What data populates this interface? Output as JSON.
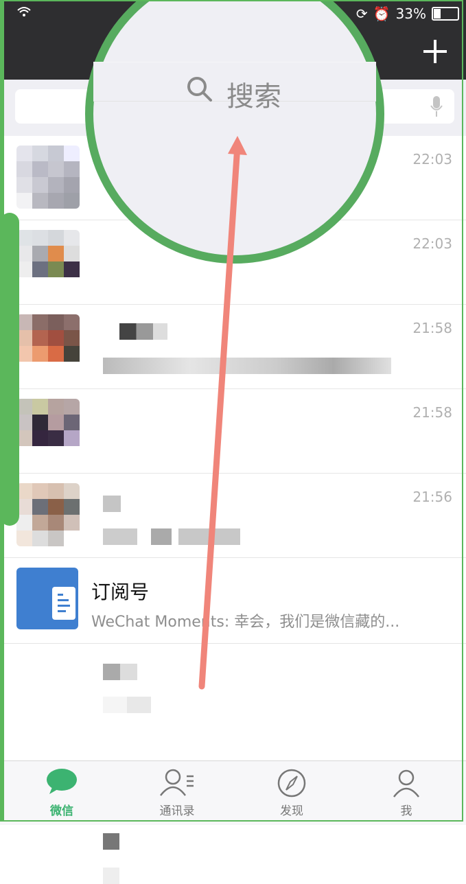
{
  "statusbar": {
    "battery": "33%"
  },
  "search": {
    "placeholder": "搜索"
  },
  "chats": [
    {
      "time": "22:03"
    },
    {
      "time": "22:03"
    },
    {
      "time": "21:58"
    },
    {
      "time": "21:58"
    },
    {
      "time": "21:56"
    }
  ],
  "subscription": {
    "title": "订阅号",
    "preview": "WeChat Moments: 幸会，我们是微信藏的..."
  },
  "tabs": [
    {
      "label": "微信",
      "icon": "chat-icon",
      "active": true
    },
    {
      "label": "通讯录",
      "icon": "contacts-icon",
      "active": false
    },
    {
      "label": "发现",
      "icon": "compass-icon",
      "active": false
    },
    {
      "label": "我",
      "icon": "me-icon",
      "active": false
    }
  ],
  "colors": {
    "accent": "#3cb371",
    "annotation_green": "#57ab5f",
    "arrow": "#f08070"
  }
}
